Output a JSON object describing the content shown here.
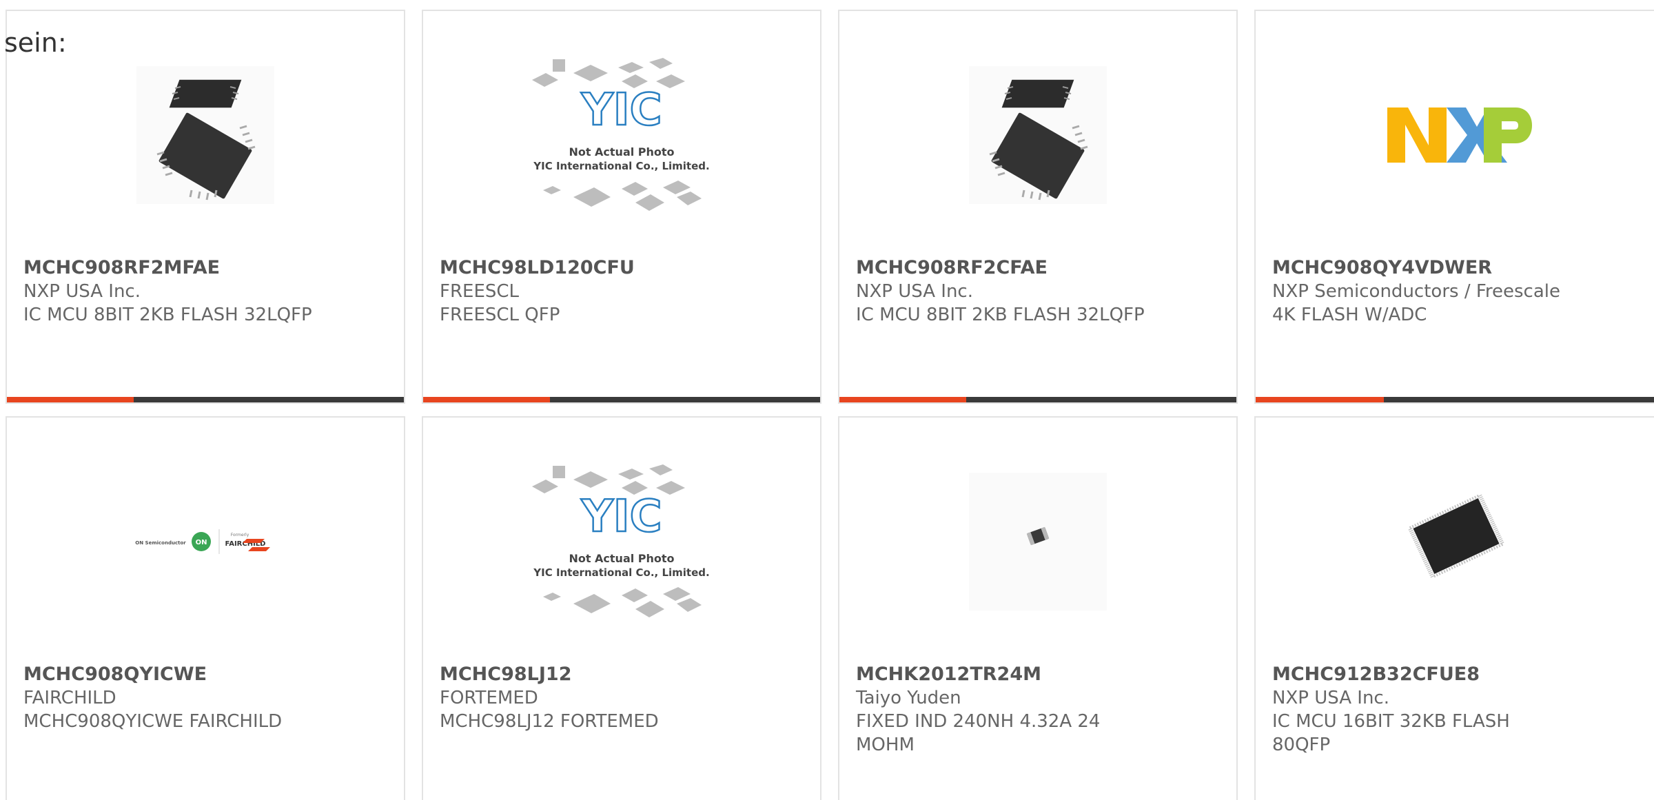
{
  "intro": {
    "text": "sein:"
  },
  "products": [
    {
      "part": "MCHC908RF2MFAE",
      "maker": "NXP USA Inc.",
      "desc": "IC MCU 8BIT 2KB FLASH 32LQFP",
      "image": "qfp-chip-stack",
      "progress": 0.32
    },
    {
      "part": "MCHC98LD120CFU",
      "maker": "FREESCL",
      "desc": "FREESCL QFP",
      "image": "yic-placeholder",
      "image_text": {
        "line1": "Not Actual Photo",
        "line2": "YIC International Co., Limited."
      },
      "progress": 0.32
    },
    {
      "part": "MCHC908RF2CFAE",
      "maker": "NXP USA Inc.",
      "desc": "IC MCU 8BIT 2KB FLASH 32LQFP",
      "image": "qfp-chip-stack",
      "progress": 0.32
    },
    {
      "part": "MCHC908QY4VDWER",
      "maker": "NXP Semiconductors / Freescale",
      "desc": "4K FLASH W/ADC",
      "image": "nxp-logo",
      "progress": 0.32
    },
    {
      "part": "MCHC908QYICWE",
      "maker": "FAIRCHILD",
      "desc": "MCHC908QYICWE FAIRCHILD",
      "image": "on-fairchild-logo",
      "image_text": {
        "left": "ON Semiconductor",
        "badge": "ON",
        "small": "Formerly",
        "brand": "FAIRCHILD"
      }
    },
    {
      "part": "MCHC98LJ12",
      "maker": "FORTEMED",
      "desc": "MCHC98LJ12 FORTEMED",
      "image": "yic-placeholder",
      "image_text": {
        "line1": "Not Actual Photo",
        "line2": "YIC International Co., Limited."
      }
    },
    {
      "part": "MCHK2012TR24M",
      "maker": "Taiyo Yuden",
      "desc": "FIXED IND 240NH 4.32A 24 MOHM",
      "image": "smd-inductor"
    },
    {
      "part": "MCHC912B32CFUE8",
      "maker": "NXP USA Inc.",
      "desc": "IC MCU 16BIT 32KB FLASH 80QFP",
      "image": "qfp80-chip"
    }
  ],
  "colors": {
    "accent": "#e8451f",
    "bar": "#3a3a3a",
    "border": "#e3e3e3",
    "nxp_n": "#f9b50b",
    "nxp_x": "#3f8fd2",
    "nxp_p": "#a5cd39",
    "yic_blue": "#2a7fc1"
  }
}
